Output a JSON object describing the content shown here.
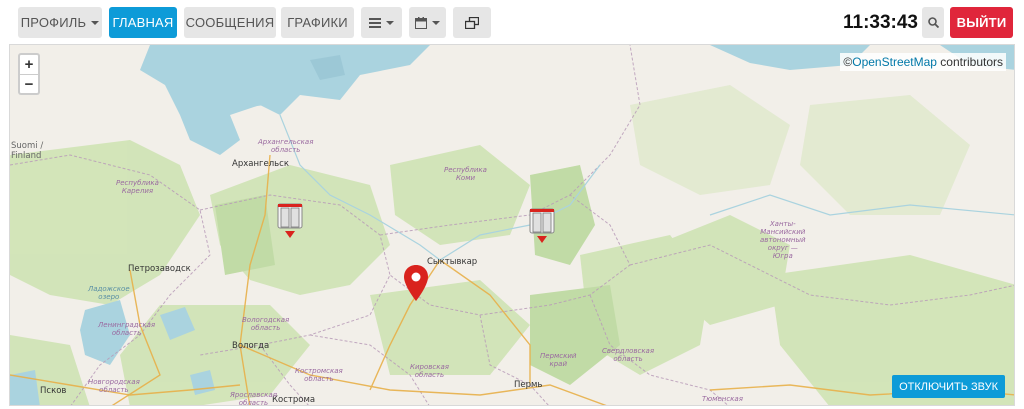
{
  "topbar": {
    "profile_label": "ПРОФИЛЬ",
    "home_label": "ГЛАВНАЯ",
    "messages_label": "СООБЩЕНИЯ",
    "charts_label": "ГРАФИКИ",
    "clock": "11:33:43",
    "logout_label": "ВЫЙТИ"
  },
  "map": {
    "attribution_prefix": "©",
    "attribution_link": "OpenStreetMap",
    "attribution_suffix": " contributors",
    "zoom_in": "+",
    "zoom_out": "−",
    "mute_button": "ОТКЛЮЧИТЬ ЗВУК",
    "labels": {
      "suomi": "Suomi /\nFinland",
      "arkhangelsk": "Архангельск",
      "arkh_obl": "Архангельская\nобласть",
      "karelia": "Республика\nКарелия",
      "komi": "Республика\nКоми",
      "petrozavodsk": "Петрозаводск",
      "ladoga": "Ладожское\nозеро",
      "lenobl": "Ленинградская\nобласть",
      "vologda_obl": "Вологодская\nобласть",
      "vologda": "Вологда",
      "kostroma_obl": "Костромская\nобласть",
      "kostroma": "Кострома",
      "yaroslavl_obl": "Ярославская\nобласть",
      "novgorod_obl": "Новгородская\nобласть",
      "pskov": "Псков",
      "syktyvkar": "Сыктывкар",
      "kirov_obl": "Кировская\nобласть",
      "perm_krai": "Пермский\nкрай",
      "perm": "Пермь",
      "sverdlovsk": "Свердловская\nобласть",
      "khmao": "Ханты-\nМансийский\nавтономный\nокруг —\nЮгра",
      "tyumen": "Тюменская"
    }
  },
  "colors": {
    "accent": "#0d9bd8",
    "danger": "#e0263b",
    "marker": "#d9231d",
    "water": "#aad3df",
    "forest": "#cfe3b4"
  }
}
